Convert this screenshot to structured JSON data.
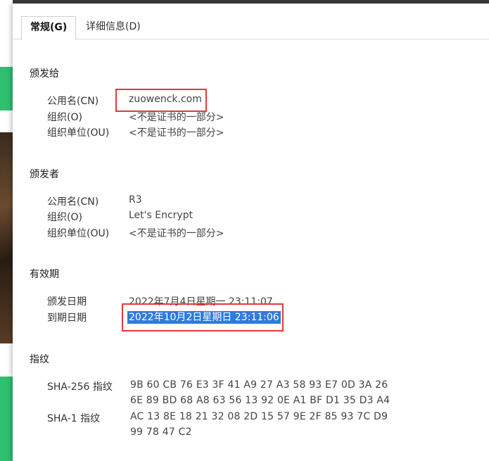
{
  "tabs": {
    "general": "常规(G)",
    "details": "详细信息(D)"
  },
  "issued_to": {
    "title": "颁发给",
    "rows": [
      {
        "label": "公用名(CN)",
        "value": "zuowenck.com"
      },
      {
        "label": "组织(O)",
        "value": "<不是证书的一部分>"
      },
      {
        "label": "组织单位(OU)",
        "value": "<不是证书的一部分>"
      }
    ]
  },
  "issued_by": {
    "title": "颁发者",
    "rows": [
      {
        "label": "公用名(CN)",
        "value": "R3"
      },
      {
        "label": "组织(O)",
        "value": "Let's Encrypt"
      },
      {
        "label": "组织单位(OU)",
        "value": "<不是证书的一部分>"
      }
    ]
  },
  "validity": {
    "title": "有效期",
    "rows": [
      {
        "label": "颁发日期",
        "value": "2022年7月4日星期一 23:11:07"
      },
      {
        "label": "到期日期",
        "value": "2022年10月2日星期日 23:11:06"
      }
    ]
  },
  "fingerprints": {
    "title": "指纹",
    "sha256_label": "SHA-256 指纹",
    "sha256_line1": "9B 60 CB 76 E3 3F 41 A9 27 A3 58 93 E7 0D 3A 26",
    "sha256_line2": "6E 89 BD 68 A8 63 56 13 92 0E A1 BF D1 35 D3 A4",
    "sha1_label": "SHA-1 指纹",
    "sha1_line1": "AC 13 8E 18 21 32 08 2D 15 57 9E 2F 85 93 7C D9",
    "sha1_line2": "99 78 47 C2"
  },
  "colors": {
    "highlight_border": "#e23a3a",
    "selection_bg": "#2e7be0",
    "background_green": "#2fbf71"
  }
}
